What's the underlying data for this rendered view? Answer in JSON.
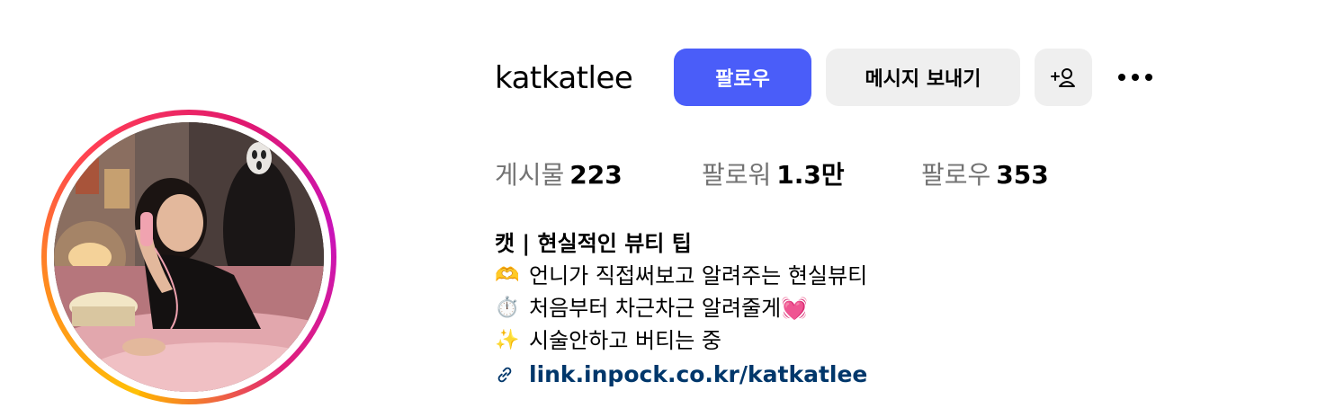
{
  "profile": {
    "username": "katkatlee",
    "avatar_icon": "profile-photo"
  },
  "actions": {
    "follow_label": "팔로우",
    "message_label": "메시지 보내기",
    "add_user_icon": "add-user-icon",
    "more_icon": "more-options-icon"
  },
  "stats": {
    "posts_label": "게시물",
    "posts_value": "223",
    "followers_label": "팔로워",
    "followers_value": "1.3만",
    "following_label": "팔로우",
    "following_value": "353"
  },
  "bio": {
    "name": "캣 | 현실적인 뷰티 팁",
    "lines": [
      {
        "emoji": "🫶",
        "text": "언니가 직접써보고 알려주는 현실뷰티"
      },
      {
        "emoji": "⏱️",
        "text": "처음부터 차근차근 알려줄게💓"
      },
      {
        "emoji": "✨",
        "text": "시술안하고 버티는 중"
      }
    ],
    "link_icon": "link-icon",
    "link": "link.inpock.co.kr/katkatlee"
  },
  "colors": {
    "follow_button": "#4a5df9",
    "secondary_button": "#efefef",
    "link": "#00376b",
    "stat_label": "#737373"
  }
}
